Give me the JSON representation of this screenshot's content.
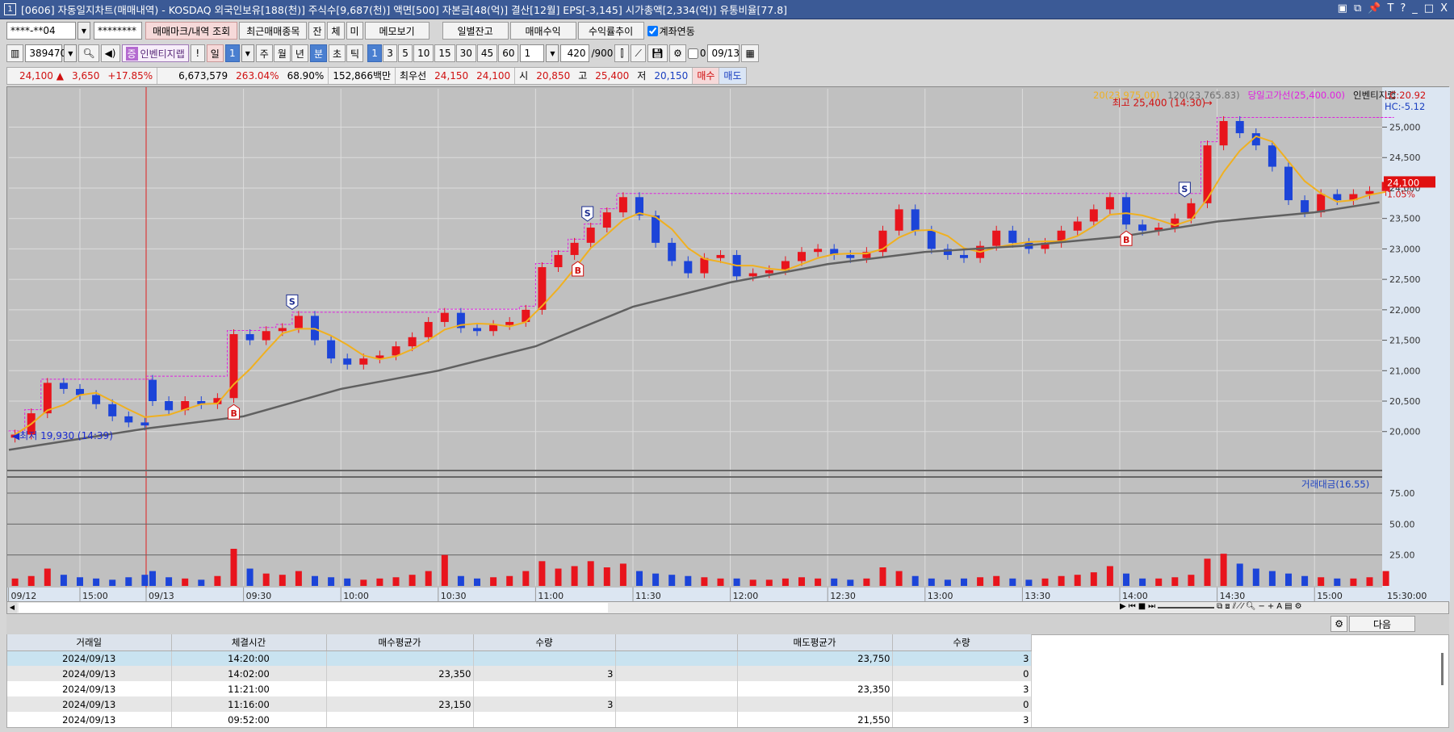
{
  "title": {
    "num": "1",
    "text": "[0606] 자동일지차트(매매내역) - KOSDAQ 외국인보유[188(천)] 주식수[9,687(천)] 액면[500] 자본금[48(억)] 결산[12월] EPS[-3,145] 시가총액[2,334(억)] 유통비율[77.8]",
    "buttons": [
      "▣",
      "⧉",
      "📌",
      "T",
      "?",
      "_",
      "□",
      "X"
    ]
  },
  "toolbar1": {
    "account": "****-**04",
    "password": "********",
    "buttons": [
      "매매마크/내역 조회",
      "최근매매종목",
      "잔",
      "체",
      "미",
      "메모보기",
      "일별잔고",
      "매매수익",
      "수익률추이"
    ],
    "link_label": "계좌연동",
    "link_checked": true
  },
  "toolbar2": {
    "code": "389470",
    "badge": "증",
    "stock_name": "인벤티지랩",
    "excl": "!",
    "period_day": "일",
    "period_num": "1",
    "periods": [
      "주",
      "월",
      "년"
    ],
    "minute": "분",
    "sub": [
      "초",
      "틱"
    ],
    "intervals": [
      "1",
      "3",
      "5",
      "10",
      "15",
      "30",
      "45",
      "60"
    ],
    "selected_interval": "1",
    "count_sel": "1",
    "count": "420",
    "count_max": "/900",
    "check_label": "0",
    "date": "09/13"
  },
  "quote": {
    "price": "24,100",
    "arrow": "▲",
    "change": "3,650",
    "pct": "+17.85%",
    "volume": "6,673,579",
    "vol_ratio": "263.04%",
    "turnover": "68.90%",
    "amount": "152,866백만",
    "best_label": "최우선",
    "ask": "24,150",
    "bid": "24,100",
    "open_label": "시",
    "open": "20,850",
    "high_label": "고",
    "high": "25,400",
    "low_label": "저",
    "low": "20,150",
    "buy": "매수",
    "sell": "매도"
  },
  "colors": {
    "up": "#e8141c",
    "down": "#1c44d8",
    "ma20": "#f0b020",
    "ma120": "#606060",
    "highline": "#e020e0",
    "title_bg": "#3b5a96"
  },
  "chart_data": {
    "type": "candlestick",
    "stock": "인벤티지랩",
    "legend": {
      "ma20": "20(23,975.00)",
      "ma120": "120(23,765.83)",
      "highline": "당일고가선(25,400.00)",
      "name": "인벤티지랩",
      "lc": "LC:20.92",
      "hc": "HC:-5.12"
    },
    "ylim": [
      19400,
      25630
    ],
    "yticks": [
      20000,
      20500,
      21000,
      21500,
      22000,
      22500,
      23000,
      23500,
      24000,
      24500,
      25000
    ],
    "ytick_labels": [
      "20,000",
      "20,500",
      "21,000",
      "21,500",
      "22,000",
      "22,500",
      "23,000",
      "23,500",
      "24,000",
      "24,500",
      "25,000"
    ],
    "current": {
      "price": 24100,
      "label": "24,100",
      "pct": "1.05%"
    },
    "annotations": {
      "low": "최저 19,930 (14:39)",
      "high": "최고 25,400 (14:30)"
    },
    "day1": {
      "date": "09/12",
      "times": [
        "14:40",
        "14:45",
        "14:50",
        "14:55",
        "15:00",
        "15:05",
        "15:10",
        "15:15",
        "15:20"
      ],
      "closes": [
        19950,
        20300,
        20800,
        20700,
        20600,
        20450,
        20250,
        20150,
        20100
      ],
      "volumes": [
        6,
        8,
        14,
        9,
        7,
        6,
        5,
        7,
        9
      ]
    },
    "day2": {
      "date": "09/13",
      "open": 20850,
      "start": "09:00",
      "step_min": 5,
      "closes": [
        20500,
        20350,
        20500,
        20450,
        20550,
        21600,
        21500,
        21650,
        21700,
        21900,
        21500,
        21200,
        21100,
        21200,
        21250,
        21400,
        21550,
        21800,
        21950,
        21700,
        21650,
        21750,
        21800,
        22000,
        22700,
        22900,
        23100,
        23350,
        23600,
        23850,
        23550,
        23100,
        22800,
        22600,
        22850,
        22900,
        22550,
        22600,
        22650,
        22800,
        22950,
        23000,
        22900,
        22850,
        22950,
        23300,
        23650,
        23300,
        23000,
        22900,
        22850,
        23050,
        23300,
        23100,
        23000,
        23100,
        23300,
        23450,
        23650,
        23850,
        23400,
        23300,
        23350,
        23500,
        23750,
        24700,
        25100,
        24900,
        24700,
        24350,
        23800,
        23600,
        23900,
        23800,
        23900,
        23950,
        24100
      ],
      "volumes": [
        12,
        7,
        6,
        5,
        8,
        30,
        14,
        10,
        9,
        12,
        8,
        7,
        6,
        5,
        6,
        7,
        9,
        12,
        25,
        8,
        6,
        7,
        8,
        12,
        20,
        14,
        16,
        20,
        15,
        18,
        12,
        10,
        9,
        8,
        7,
        6,
        6,
        5,
        5,
        6,
        7,
        6,
        6,
        5,
        6,
        15,
        12,
        8,
        6,
        5,
        6,
        7,
        8,
        6,
        5,
        6,
        8,
        9,
        11,
        16,
        10,
        6,
        6,
        7,
        9,
        22,
        26,
        18,
        14,
        12,
        10,
        8,
        7,
        6,
        6,
        7,
        12
      ]
    },
    "ma120": [
      [
        "09/12 14:40",
        19700
      ],
      [
        "09/13 09:00",
        20050
      ],
      [
        "09:30",
        20250
      ],
      [
        "10:00",
        20700
      ],
      [
        "10:30",
        21000
      ],
      [
        "11:00",
        21400
      ],
      [
        "11:30",
        22050
      ],
      [
        "12:00",
        22450
      ],
      [
        "12:30",
        22750
      ],
      [
        "13:00",
        22950
      ],
      [
        "13:30",
        23050
      ],
      [
        "14:00",
        23200
      ],
      [
        "14:30",
        23450
      ],
      [
        "15:00",
        23600
      ],
      [
        "15:20",
        23766
      ]
    ],
    "ma_period": 20,
    "markers": [
      {
        "type": "B",
        "time": "09:27"
      },
      {
        "type": "S",
        "time": "09:45"
      },
      {
        "type": "B",
        "time": "11:13"
      },
      {
        "type": "S",
        "time": "11:16"
      },
      {
        "type": "B",
        "time": "14:02"
      },
      {
        "type": "S",
        "time": "14:20"
      }
    ],
    "xtick_labels": [
      {
        "t": "09/12",
        "d": 1,
        "m": "14:38"
      },
      {
        "t": "15:00",
        "d": 1,
        "m": "15:00"
      },
      {
        "t": "09/13",
        "d": 2,
        "m": "09:00"
      },
      {
        "t": "09:30",
        "d": 2,
        "m": "09:30"
      },
      {
        "t": "10:00",
        "d": 2,
        "m": "10:00"
      },
      {
        "t": "10:30",
        "d": 2,
        "m": "10:30"
      },
      {
        "t": "11:00",
        "d": 2,
        "m": "11:00"
      },
      {
        "t": "11:30",
        "d": 2,
        "m": "11:30"
      },
      {
        "t": "12:00",
        "d": 2,
        "m": "12:00"
      },
      {
        "t": "12:30",
        "d": 2,
        "m": "12:30"
      },
      {
        "t": "13:00",
        "d": 2,
        "m": "13:00"
      },
      {
        "t": "13:30",
        "d": 2,
        "m": "13:30"
      },
      {
        "t": "14:00",
        "d": 2,
        "m": "14:00"
      },
      {
        "t": "14:30",
        "d": 2,
        "m": "14:30"
      },
      {
        "t": "15:00",
        "d": 2,
        "m": "15:00"
      }
    ],
    "xaxis_end": "15:30:00",
    "volume_pane": {
      "legend": "거래대금(16.55)",
      "yticks": [
        25,
        50,
        75
      ],
      "ytick_labels": [
        "25.00",
        "50.00",
        "75.00"
      ],
      "ylim": [
        0,
        90
      ]
    }
  },
  "table_toolbar": {
    "next": "다음"
  },
  "table": {
    "headers": [
      "거래일",
      "체결시간",
      "매수평균가",
      "수량",
      "",
      "매도평균가",
      "수량"
    ],
    "rows": [
      [
        "2024/09/13",
        "14:20:00",
        "",
        "",
        "",
        "23,750",
        "3"
      ],
      [
        "2024/09/13",
        "14:02:00",
        "23,350",
        "3",
        "",
        "",
        "0"
      ],
      [
        "2024/09/13",
        "11:21:00",
        "",
        "",
        "",
        "23,350",
        "3"
      ],
      [
        "2024/09/13",
        "11:16:00",
        "23,150",
        "3",
        "",
        "",
        "0"
      ],
      [
        "2024/09/13",
        "09:52:00",
        "",
        "",
        "",
        "21,550",
        "3"
      ]
    ]
  }
}
